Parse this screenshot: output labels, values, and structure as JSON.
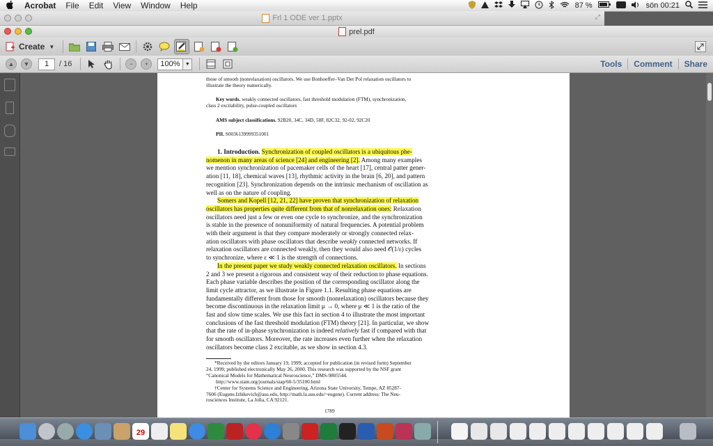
{
  "menubar": {
    "app": "Acrobat",
    "items": [
      "File",
      "Edit",
      "View",
      "Window",
      "Help"
    ],
    "battery": "87 %",
    "clock": "sön 00:21"
  },
  "background_window": {
    "title": "Frl 1 ODE ver 1.pptx"
  },
  "window": {
    "title": "prel.pdf"
  },
  "toolbar": {
    "create_label": "Create"
  },
  "navbar": {
    "page_current": "1",
    "page_total": "/ 16",
    "zoom": "100%",
    "tools": "Tools",
    "comment": "Comment",
    "share": "Share"
  },
  "document": {
    "abstract_tail": [
      "those of smooth (nonrelaxation) oscillators. We use Bonhoeffer–Van Der Pol relaxation oscillators to",
      "illustrate the theory numerically."
    ],
    "keywords_label": "Key words.",
    "keywords_1": "weakly connected oscillators, fast threshold modulation (FTM), synchronization,",
    "keywords_2": "class 2 excitability, pulse-coupled oscillators",
    "ams_label": "AMS subject classifications.",
    "ams_value": "92B20, 34C, 34D, 58F, 82C32, 92-02, 92C20",
    "pii_label": "PII.",
    "pii_value": "S0036139999351001",
    "section_title": "1. Introduction.",
    "p1_hl_a": "Synchronization of coupled oscillators is a ubiquitous phe-",
    "p1_hl_b": "nomenon in many areas of science [24] and engineering [2].",
    "p1_tail_b": " Among many examples",
    "p1_lines": [
      "we mention synchronization of pacemaker cells of the heart [17], central patter gener-",
      "ation [11, 18], chemical waves [13], rhythmic activity in the brain [6, 20], and pattern",
      "recognition [23]. Synchronization depends on the intrinsic mechanism of oscillation as",
      "well as on the nature of coupling."
    ],
    "p2_hl_a": "Somers and Kopell [12, 21, 22] have proven that synchronization of relaxation",
    "p2_hl_b": "oscillators has properties quite different from that of nonrelaxation ones:",
    "p2_tail_b": " Relaxation",
    "p2_lines": [
      "oscillators need just a few or even one cycle to synchronize, and the synchronization",
      "is stable in the presence of nonuniformity of natural frequencies. A potential problem",
      "with their argument is that they compare moderately or strongly connected relax-"
    ],
    "p2_line_weakly_a": "ation oscillators with phase oscillators that describe ",
    "p2_line_weakly_i": "weakly",
    "p2_line_weakly_b": " connected networks. If",
    "p2_line_last_1": "relaxation oscillators are connected weakly, then they would also need 𝒪(1/ε) cycles",
    "p2_line_last_2": "to synchronize, where ε ≪ 1 is the strength of connections.",
    "p3_hl": "In the present paper we study weakly connected relaxation oscillators.",
    "p3_tail": " In sections",
    "p3_lines": [
      "2 and 3 we present a rigorous and consistent way of their reduction to phase equations.",
      "Each phase variable describes the position of the corresponding oscillator along the",
      "limit cycle attractor, as we illustrate in Figure 1.1. Resulting phase equations are",
      "fundamentally different from those for smooth (nonrelaxation) oscillators because they",
      "become discontinuous in the relaxation limit μ → 0, where μ ≪ 1 is the ratio of the",
      "fast and slow time scales. We use this fact in section 4 to illustrate the most important",
      "conclusions of the fast threshold modulation (FTM) theory [21]. In particular, we show"
    ],
    "p3_rel_a": "that the rate of in-phase synchronization is indeed ",
    "p3_rel_i": "relatively",
    "p3_rel_b": " fast if compared with that",
    "p3_end_1": "for smooth oscillators. Moreover, the rate increases even further when the relaxation",
    "p3_end_2": "oscillators become class 2 excitable, as we show in section 4.3.",
    "footnotes": [
      "*Received by the editors January 19, 1999; accepted for publication (in revised form) September",
      "24, 1999; published electronically May 26, 2000. This research was supported by the NSF grant",
      "“Canonical Models for Mathematical Neuroscience,” DMS-9805544.",
      "http://www.siam.org/journals/siap/60-5/35100.html",
      "†Center for Systems Science and Engineering, Arizona State University, Tempe, AZ 85287-",
      "7606 (Eugene.Izhikevich@asu.edu, http://math.la.asu.edu/~eugene). Current address: The Neu-",
      "rosciences Institute, La Jolla, CA 92121."
    ],
    "page_number": "1789"
  },
  "dock": {
    "calendar_day": "29"
  },
  "colors": {
    "highlight": "#fbf84a",
    "link": "#3f5f86"
  }
}
